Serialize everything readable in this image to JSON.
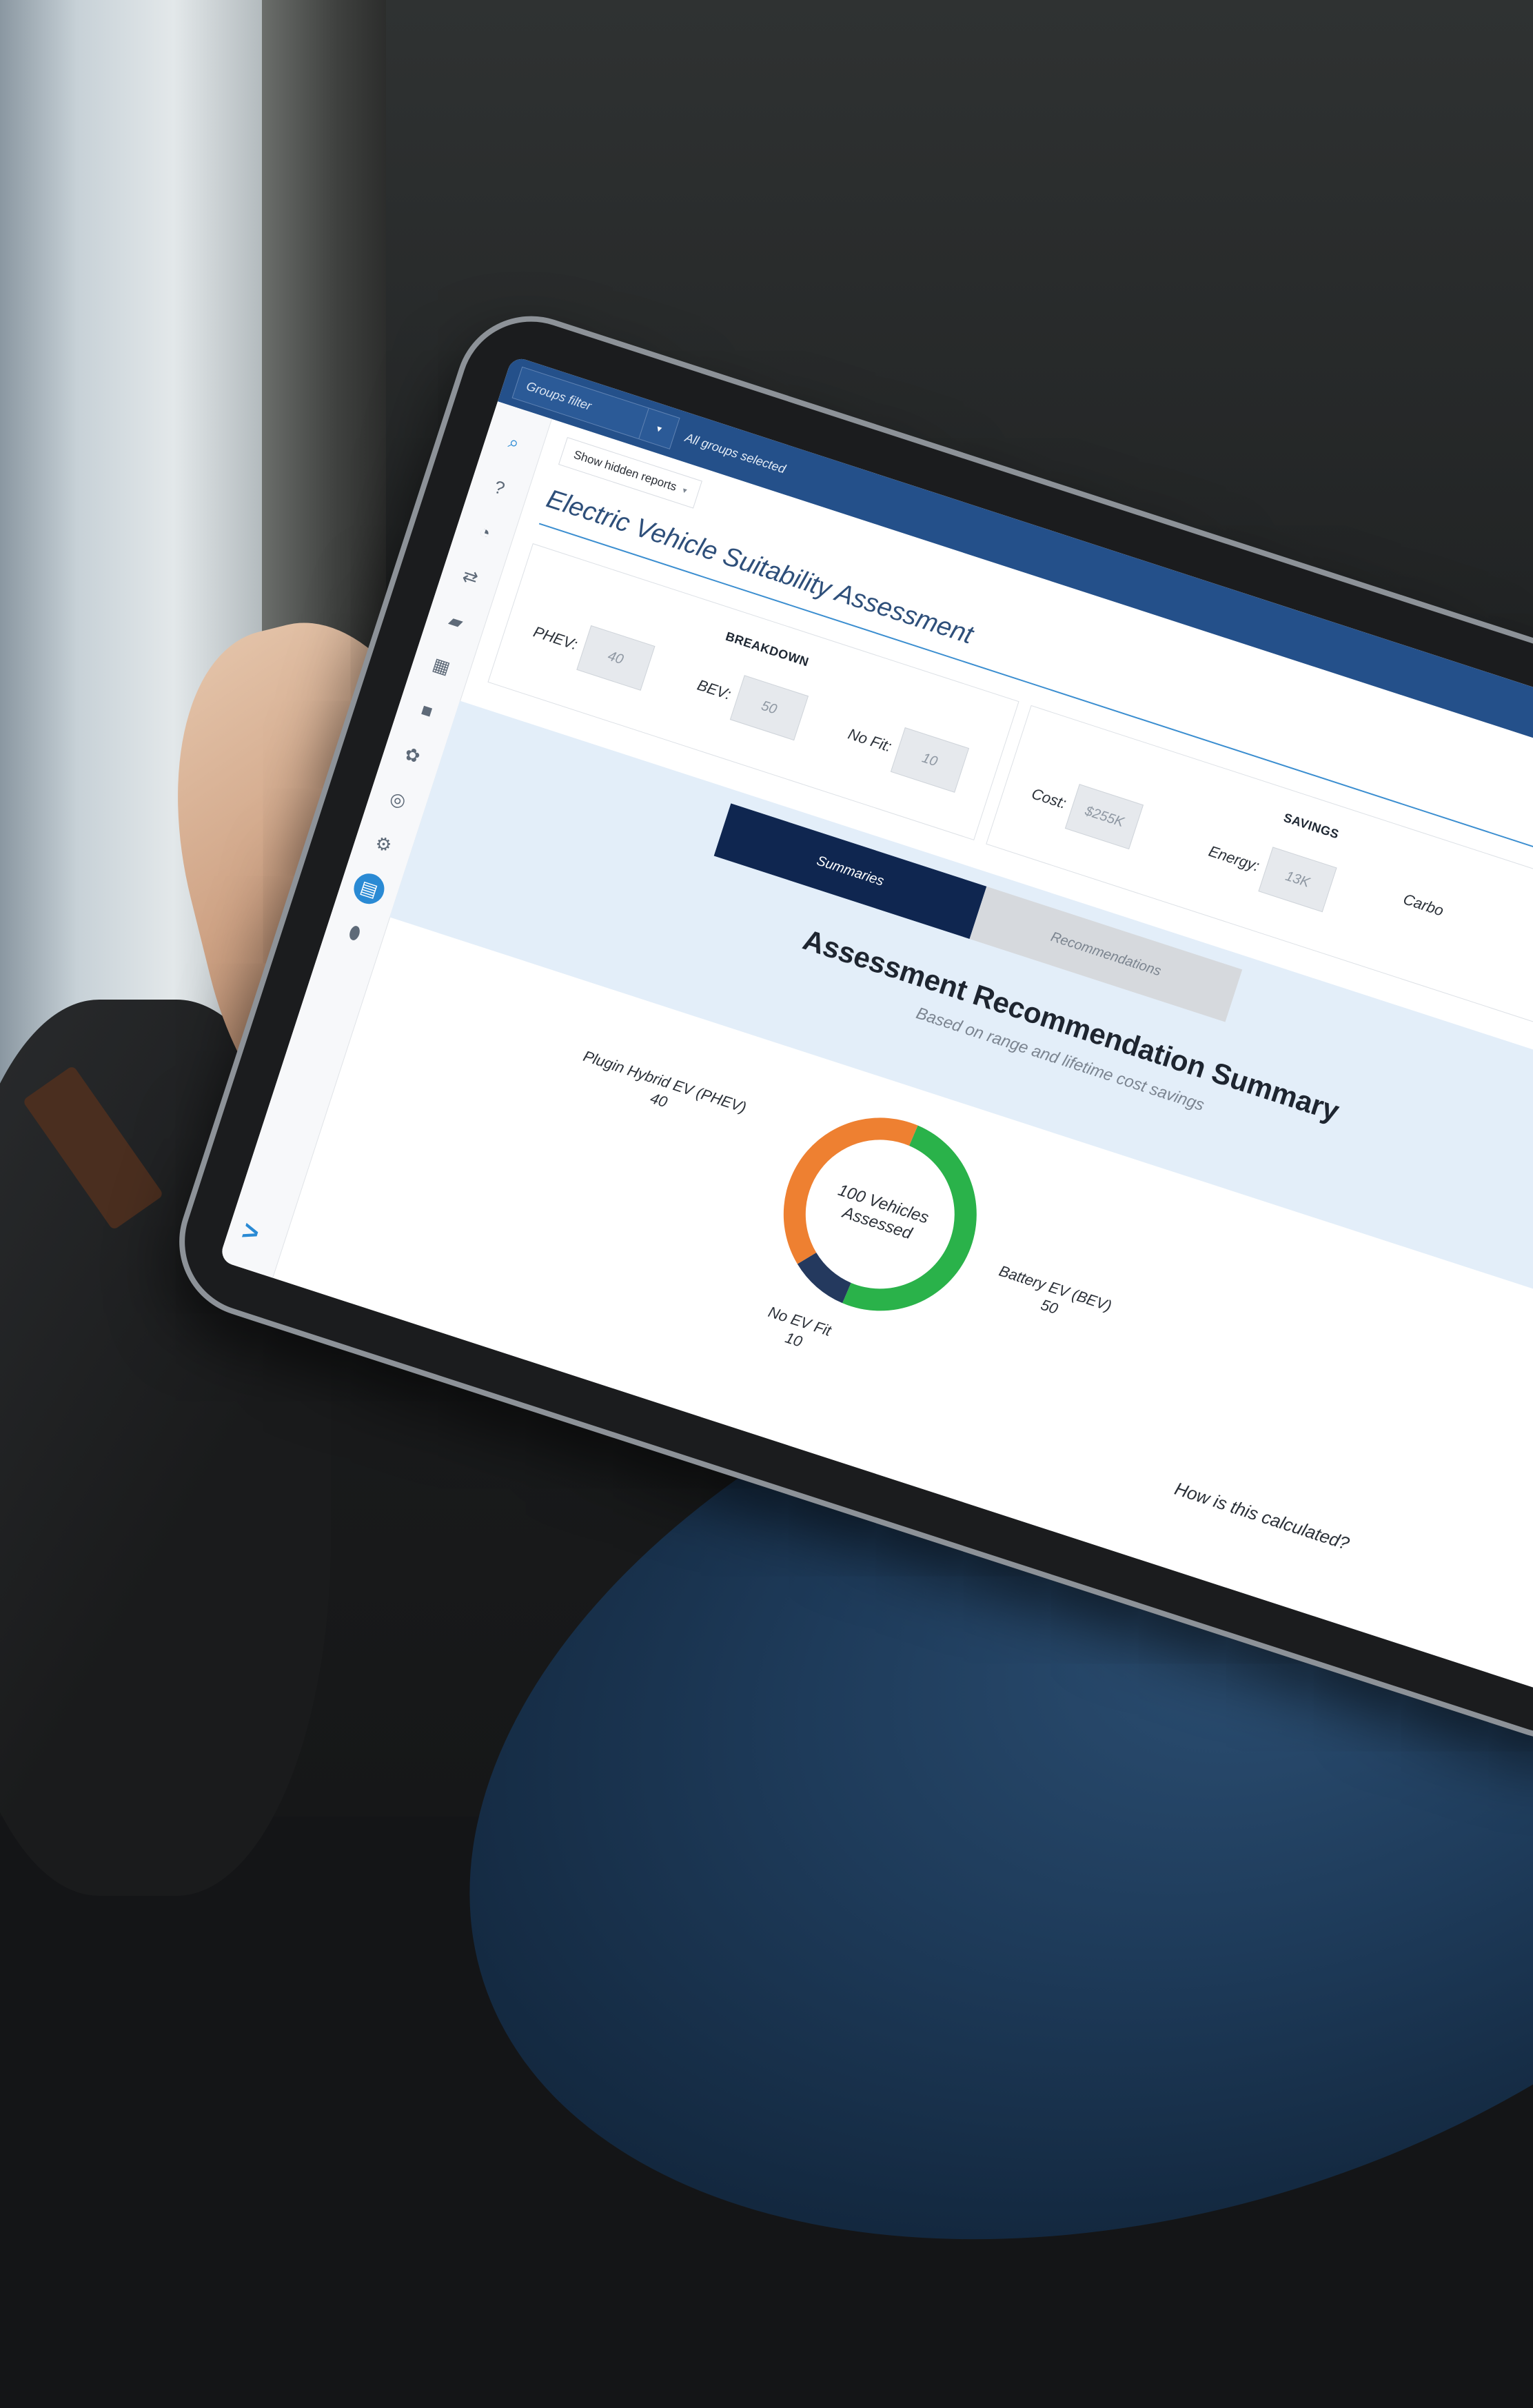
{
  "topbar": {
    "groups_filter_label": "Groups filter",
    "groups_selected_text": "All groups selected"
  },
  "toolbar": {
    "show_hidden_reports_label": "Show hidden reports"
  },
  "report": {
    "title": "Electric Vehicle Suitability Assessment"
  },
  "breakdown": {
    "heading": "BREAKDOWN",
    "phev_label": "PHEV:",
    "phev_value": "40",
    "bev_label": "BEV:",
    "bev_value": "50",
    "nofit_label": "No Fit:",
    "nofit_value": "10"
  },
  "savings": {
    "heading": "SAVINGS",
    "cost_label": "Cost:",
    "cost_value": "$255K",
    "energy_label": "Energy:",
    "energy_value": "13K",
    "carbon_label_partial": "Carbo"
  },
  "tabs": {
    "summaries_label": "Summaries",
    "recommendations_label": "Recommendations"
  },
  "summary": {
    "title": "Assessment Recommendation Summary",
    "subtitle": "Based on range and lifetime cost savings",
    "center_line1": "100 Vehicles",
    "center_line2": "Assessed",
    "phev_name": "Plugin Hybrid EV (PHEV)",
    "phev_count": "40",
    "bev_name": "Battery EV (BEV)",
    "bev_count": "50",
    "nofit_name": "No EV Fit",
    "nofit_count": "10",
    "how_calculated_label": "How is this calculated?"
  },
  "chart_data": {
    "type": "pie",
    "categories": [
      "Plugin Hybrid EV (PHEV)",
      "Battery EV (BEV)",
      "No EV Fit"
    ],
    "values": [
      40,
      50,
      10
    ],
    "colors": [
      "#ee8031",
      "#2ab24a",
      "#24395e"
    ],
    "center_text": "100 Vehicles Assessed"
  },
  "icons": {
    "search": "search-icon",
    "help": "help-icon",
    "speed": "gauge-icon",
    "routes": "route-icon",
    "vehicles": "truck-icon",
    "reports": "chart-icon",
    "engine": "engine-icon",
    "rules": "puzzle-icon",
    "zones": "compass-icon",
    "settings": "gear-icon",
    "active_report": "report-icon",
    "map": "map-pin-icon",
    "expand": "chevron-right-icon"
  },
  "colors": {
    "accent": "#2a8ad4",
    "topbar": "#24508a",
    "tab_active": "#0f2650"
  }
}
